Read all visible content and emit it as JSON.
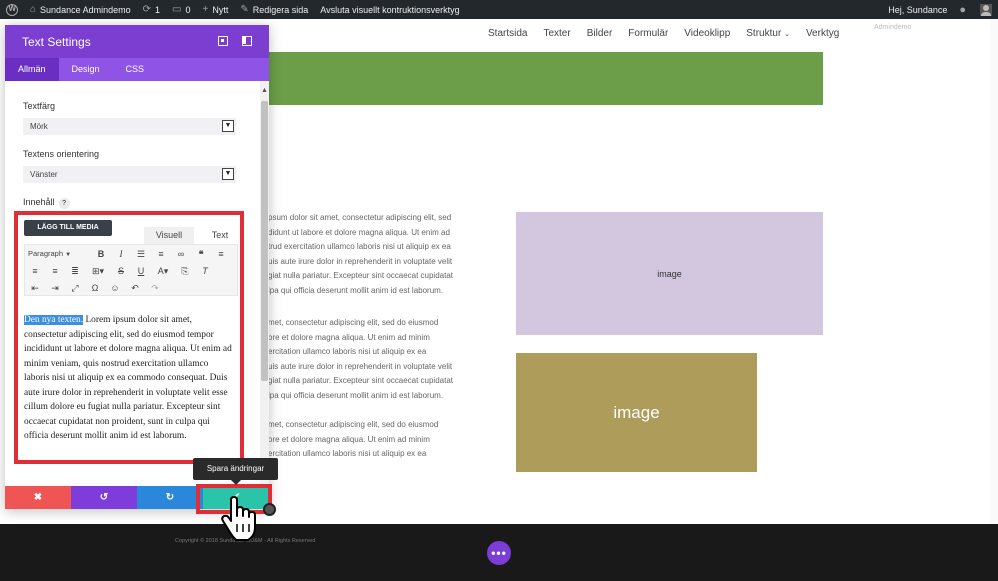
{
  "adminbar": {
    "site_name": "Sundance Admindemo",
    "updates_count": "1",
    "comments_count": "0",
    "new_label": "Nytt",
    "edit_page": "Redigera sida",
    "exit_builder": "Avsluta visuellt kontruktionsverktyg",
    "greeting": "Hej, Sundance"
  },
  "site": {
    "nav": [
      "Startsida",
      "Texter",
      "Bilder",
      "Formulär",
      "Videoklipp",
      "Struktur",
      "Verktyg"
    ],
    "admin_ghost": "Admindemo",
    "lorem_blocks": [
      [
        "psum dolor sit amet, consectetur adipiscing elit, sed",
        "didunt ut labore et dolore magna aliqua. Ut enim ad",
        "trud exercitation ullamco laboris nisi ut aliquip ex ea",
        "uis aute irure dolor in reprehenderit in voluptate velit",
        "giat nulla pariatur. Excepteur sint occaecat cupidatat",
        "lpa qui officia deserunt mollit anim id est laborum."
      ],
      [
        "met, consectetur adipiscing elit, sed do eiusmod",
        "ore et dolore magna aliqua. Ut enim ad minim",
        "ercitation ullamco laboris nisi ut aliquip ex ea",
        "uis aute irure dolor in reprehenderit in voluptate velit",
        "giat nulla pariatur. Excepteur sint occaecat cupidatat",
        "lpa qui officia deserunt mollit anim id est laborum."
      ],
      [
        "met, consectetur adipiscing elit, sed do eiusmod",
        "ore et dolore magna aliqua. Ut enim ad minim",
        "ercitation ullamco laboris nisi ut aliquip ex ea"
      ]
    ],
    "image_label_small": "image",
    "image_label_large": "image",
    "footer_copy": "Copyright © 2018 Sundance MD&M - All Rights Reserved",
    "footer_dots": "•••"
  },
  "modal": {
    "title": "Text Settings",
    "tabs": [
      "Allmän",
      "Design",
      "CSS"
    ],
    "text_color_label": "Textfärg",
    "text_color_value": "Mörk",
    "orientation_label": "Textens orientering",
    "orientation_value": "Vänster",
    "content_label": "Innehåll",
    "help": "?",
    "editor": {
      "add_media": "LÄGG TILL MEDIA",
      "tab_visual": "Visuell",
      "tab_text": "Text",
      "format_select": "Paragraph",
      "highlighted": "Den nya texten.",
      "body": " Lorem ipsum dolor sit amet, consectetur adipiscing elit, sed do eiusmod tempor incididunt ut labore et dolore magna aliqua. Ut enim ad minim veniam, quis nostrud exercitation ullamco laboris nisi ut aliquip ex ea commodo consequat. Duis aute irure dolor in reprehenderit in voluptate velit esse cillum dolore eu fugiat nulla pariatur. Excepteur sint occaecat cupidatat non proident, sunt in culpa qui officia deserunt mollit anim id est laborum."
    },
    "actions": {
      "discard": "✖",
      "undo": "↺",
      "redo": "↻",
      "save": "✔"
    },
    "tooltip": "Spara ändringar"
  },
  "colors": {
    "modal_header": "#7b3ed0",
    "modal_tabs": "#8f53e6",
    "discard": "#ef5555",
    "undo": "#7e3ddb",
    "redo": "#2b87da",
    "save": "#29c4a9",
    "highlight_frame": "#e02e36"
  }
}
